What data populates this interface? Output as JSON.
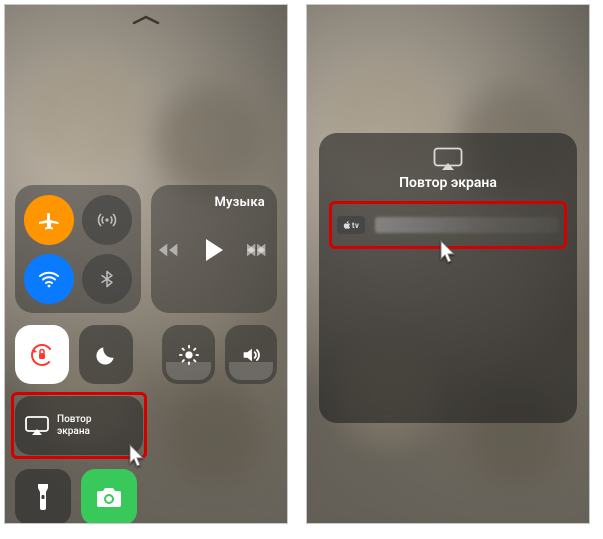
{
  "left": {
    "music_label": "Музыка",
    "mirror_label": "Повтор\nэкрана"
  },
  "right": {
    "panel_title": "Повтор экрана",
    "device_badge": "tv"
  }
}
